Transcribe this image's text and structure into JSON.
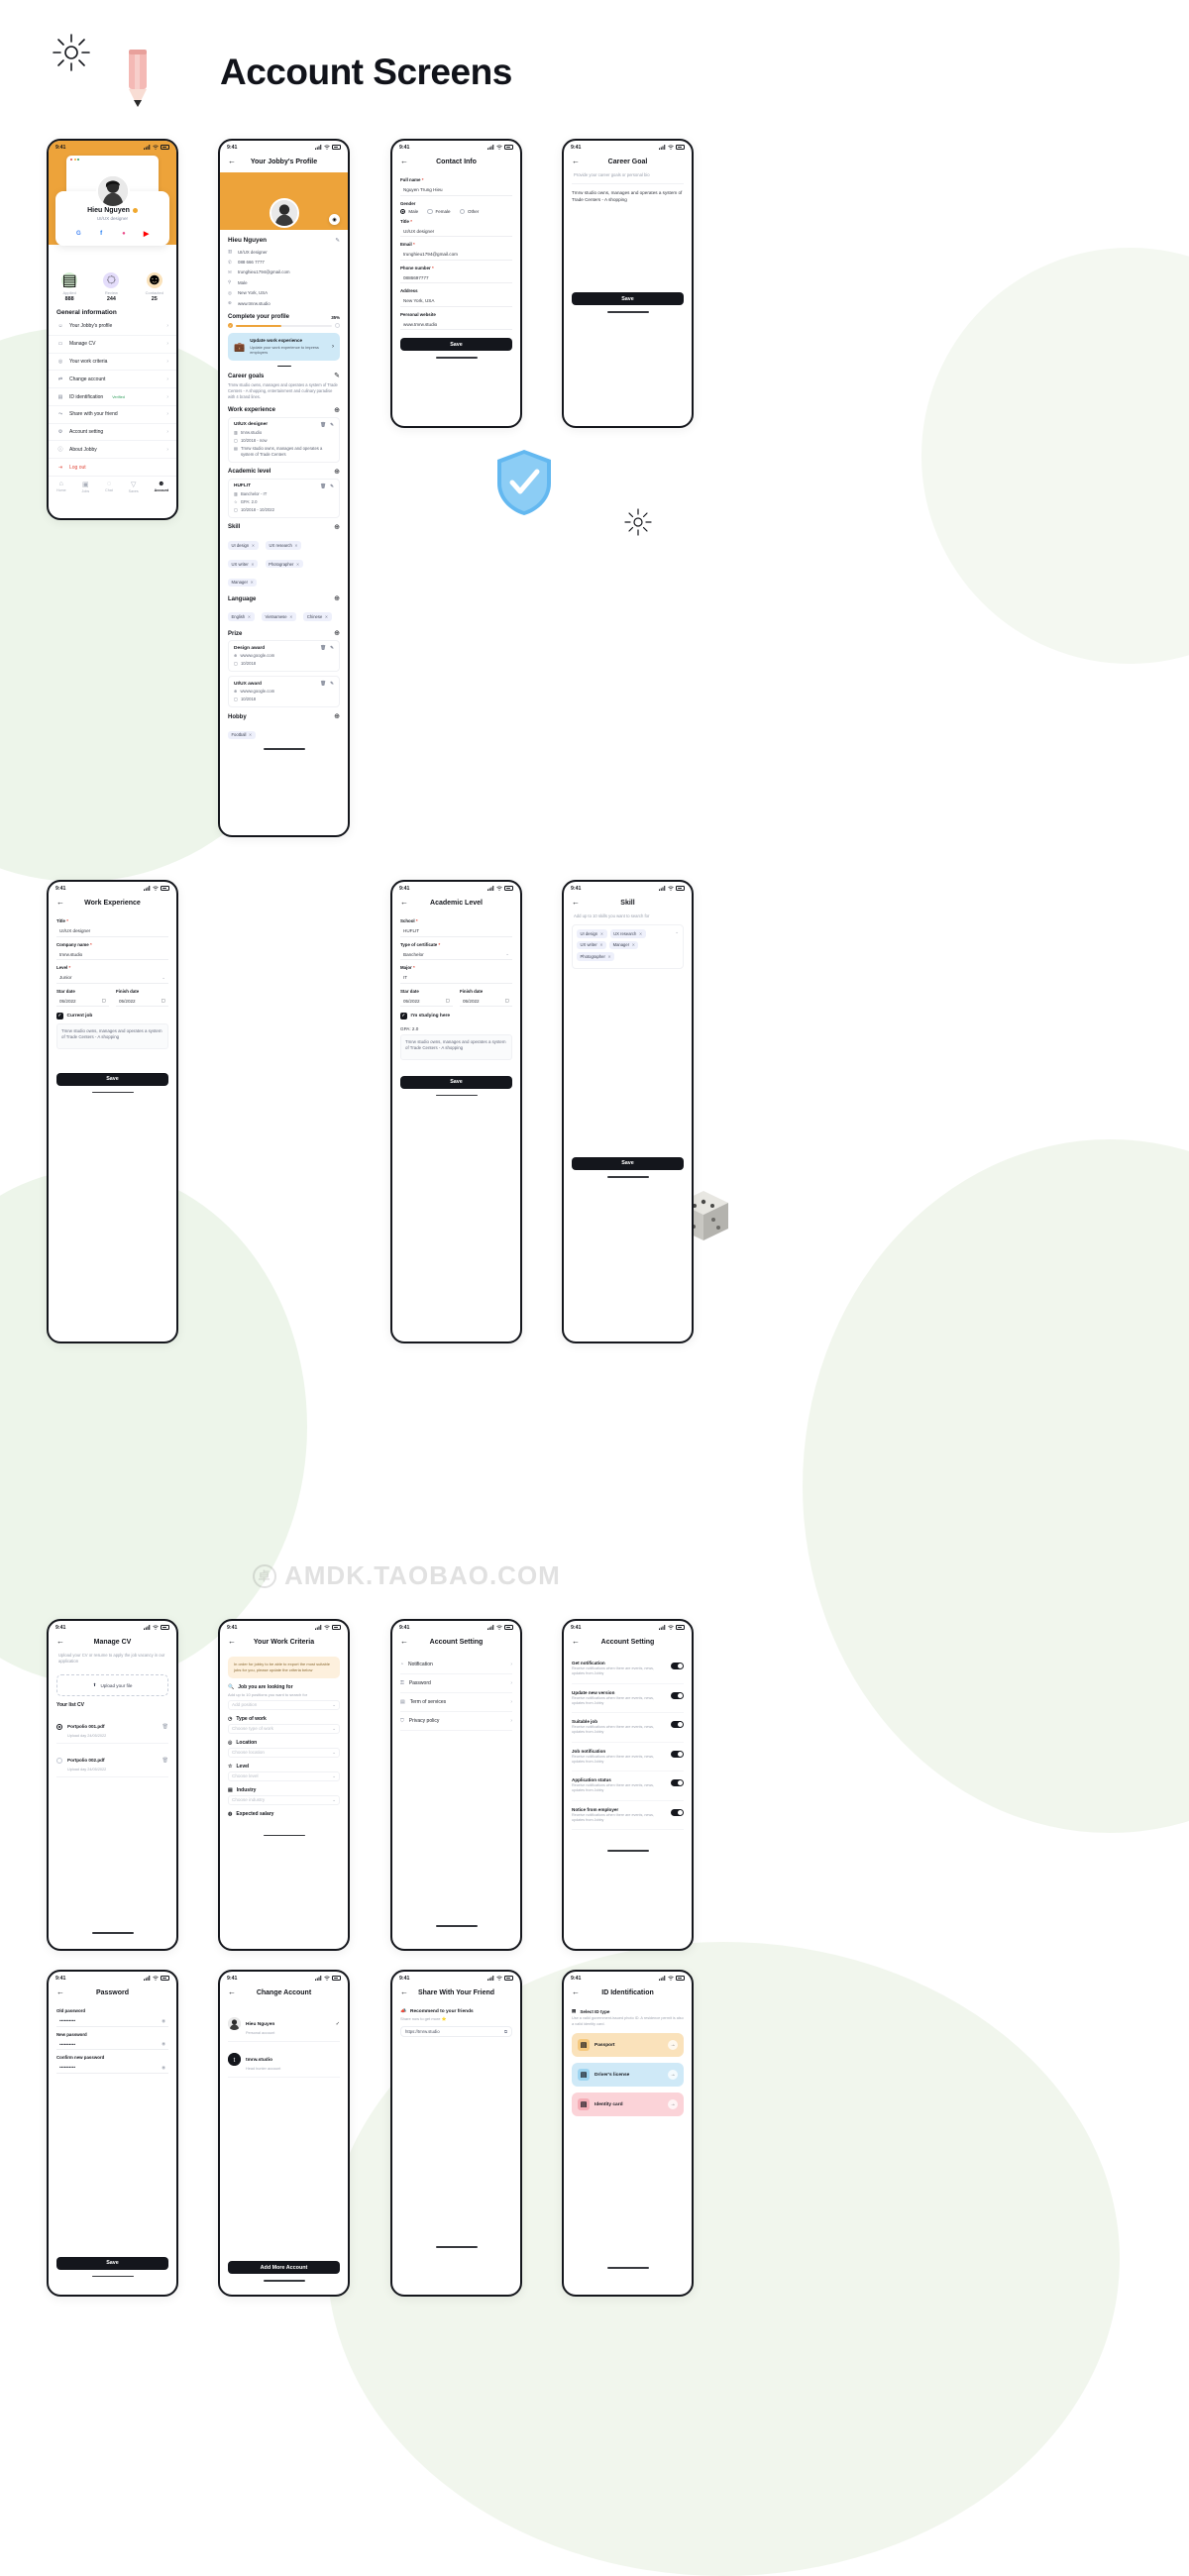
{
  "header": {
    "title": "Account Screens"
  },
  "watermark": "AMDK.TAOBAO.COM",
  "common": {
    "time": "9:41",
    "back_icon": "←",
    "save_label": "Save",
    "chevron": "›",
    "plus_icon": "⊕",
    "edit_icon": "✎",
    "trash_icon": "🗑",
    "calendar_icon": "▢",
    "required": "*"
  },
  "screens": {
    "account": {
      "nav_title": "",
      "user": {
        "name": "Hieu Nguyen",
        "role": "UI/UX designer"
      },
      "socials": [
        {
          "name": "google-icon",
          "glyph": "G",
          "color": "#4285F4",
          "bg": "#ffffff"
        },
        {
          "name": "facebook-icon",
          "glyph": "f",
          "color": "#1877F2",
          "bg": "#ffffff"
        },
        {
          "name": "dribbble-icon",
          "glyph": "●",
          "color": "#EA4C89",
          "bg": "#ffffff"
        },
        {
          "name": "youtube-icon",
          "glyph": "▶",
          "color": "#FF0000",
          "bg": "#ffffff"
        }
      ],
      "stats": [
        {
          "label": "Applied",
          "value": "888",
          "bg": "#d9f2d6"
        },
        {
          "label": "Review",
          "value": "244",
          "bg": "#e4ddfb"
        },
        {
          "label": "Contacted",
          "value": "25",
          "bg": "#fae2bb"
        }
      ],
      "section_title": "General information",
      "menu": [
        {
          "label": "Your Jobby's profile",
          "icon": "person-icon",
          "glyph": "☺"
        },
        {
          "label": "Manage CV",
          "icon": "folder-icon",
          "glyph": "▭"
        },
        {
          "label": "Your work criteria",
          "icon": "target-icon",
          "glyph": "◎"
        },
        {
          "label": "Change account",
          "icon": "switch-user-icon",
          "glyph": "⇄"
        },
        {
          "label": "ID identification",
          "icon": "id-card-icon",
          "glyph": "▤",
          "badge": "Verified"
        },
        {
          "label": "Share with your friend",
          "icon": "share-icon",
          "glyph": "⤳"
        },
        {
          "label": "Account setting",
          "icon": "gear-icon",
          "glyph": "⚙"
        },
        {
          "label": "About Jobby",
          "icon": "info-icon",
          "glyph": "ⓘ"
        },
        {
          "label": "Log out",
          "icon": "logout-icon",
          "glyph": "⇥"
        }
      ],
      "tabs": [
        {
          "label": "Home",
          "glyph": "⌂"
        },
        {
          "label": "Jobs",
          "glyph": "▣"
        },
        {
          "label": "Chat",
          "glyph": "◌"
        },
        {
          "label": "Saves",
          "glyph": "▽"
        },
        {
          "label": "Account",
          "glyph": "☻"
        }
      ]
    },
    "profile": {
      "nav_title": "Your Jobby's Profile",
      "name": "Hieu Nguyen",
      "details": [
        {
          "icon": "briefcase-icon",
          "glyph": "▥",
          "text": "UI/UX designer"
        },
        {
          "icon": "phone-icon",
          "glyph": "✆",
          "text": "088 666 7777"
        },
        {
          "icon": "mail-icon",
          "glyph": "✉",
          "text": "trunghieu1794@gmail.com"
        },
        {
          "icon": "gender-icon",
          "glyph": "⚲",
          "text": "Male"
        },
        {
          "icon": "location-icon",
          "glyph": "◎",
          "text": "New York, USA"
        },
        {
          "icon": "globe-icon",
          "glyph": "⊕",
          "text": "www.tmrw.studio"
        }
      ],
      "complete_title": "Complete your profile",
      "complete_pct": "35%",
      "tip": {
        "title": "Update work experience",
        "desc": "Update your work experience to impress employers",
        "icon": "briefcase-emoji"
      },
      "career_title": "Career goals",
      "career_text": "Tmrw studio owns, manages and operates a system of Trade Centers - A shopping, entertainment and culinary paradise with 4 brand lines.",
      "work_title": "Work experience",
      "work": [
        {
          "title": "UI/UX designer",
          "company": "tmrw.studio",
          "date": "10/2018 - now",
          "desc": "Tmrw studio owns, manages and operates a system of Trade Centers"
        }
      ],
      "academic_title": "Academic level",
      "academic": [
        {
          "school": "HUFLIT",
          "major": "Banchelor - IT",
          "gpa": "GPA: 2.0",
          "date": "10/2018 - 10/2022"
        }
      ],
      "skill_title": "Skill",
      "skills": [
        "UI design",
        "UX research",
        "UX writer",
        "Photographer",
        "Manager"
      ],
      "language_title": "Language",
      "languages": [
        "English",
        "Vietnamese",
        "Chinese"
      ],
      "prize_title": "Prize",
      "prizes": [
        {
          "name": "Design award",
          "link": "wwww.google.com",
          "date": "10/2018"
        },
        {
          "name": "UI/UX award",
          "link": "wwww.google.com",
          "date": "10/2018"
        }
      ],
      "hobby_title": "Hobby",
      "hobbies": [
        "Football"
      ]
    },
    "contact": {
      "nav_title": "Contact Info",
      "fields": [
        {
          "label": "Full name",
          "req": true,
          "value": "Nguyen Trung Hieu"
        },
        {
          "label": "Title",
          "req": true,
          "value": "UI/UX designer"
        },
        {
          "label": "Email",
          "req": true,
          "value": "trunghieu1794@gmail.com"
        },
        {
          "label": "Phone number",
          "req": true,
          "value": "0886697777"
        },
        {
          "label": "Address",
          "req": false,
          "value": "New York, USA"
        },
        {
          "label": "Personal website",
          "req": false,
          "value": "www.tmrw.studio"
        }
      ],
      "gender_label": "Gender",
      "gender_options": [
        "Male",
        "Female",
        "Other"
      ],
      "gender_selected": "Male"
    },
    "career_goal": {
      "nav_title": "Career Goal",
      "subtitle": "Provide your career goals or personal bio",
      "value": "Tmrw studio owns, manages and operates a system of Trade Centers - A shopping"
    },
    "work_experience": {
      "nav_title": "Work Experience",
      "fields": [
        {
          "label": "Title",
          "req": true,
          "value": "UI/UX designer"
        },
        {
          "label": "Company name",
          "req": true,
          "value": "tmrw.studio"
        },
        {
          "label": "Level",
          "req": true,
          "value": "Junior",
          "select": true
        }
      ],
      "start_label": "Star date",
      "finish_label": "Finish date",
      "start_value": "05/2022",
      "finish_value": "05/2022",
      "current_job": "Current job",
      "desc": "Tmrw studio owns, manages and operates a system of Trade Centers - A shopping"
    },
    "academic_level": {
      "nav_title": "Academic Level",
      "fields": [
        {
          "label": "School",
          "req": true,
          "value": "HUFLIT"
        },
        {
          "label": "Type of certificate",
          "req": true,
          "value": "Banchelor",
          "select": true
        },
        {
          "label": "Major",
          "req": true,
          "value": "IT"
        }
      ],
      "start_label": "Star date",
      "finish_label": "Finish date",
      "start_value": "05/2022",
      "finish_value": "05/2022",
      "studying": "I'm studying here",
      "gpa_label": "GPA: 2.0",
      "desc": "Tmrw studio owns, manages and operates a system of Trade Centers - A shopping"
    },
    "skill": {
      "nav_title": "Skill",
      "subtitle": "Add up to 10 skills you want to search for",
      "tags": [
        "UI design",
        "UX research",
        "UX writer",
        "Manager",
        "Photographer"
      ]
    },
    "manage_cv": {
      "nav_title": "Manage CV",
      "subtitle": "Upload your CV or resume to apply the job vacancy in our application",
      "upload_label": "Upload your file",
      "list_title": "Your list CV",
      "files": [
        {
          "name": "Portpolio 001.pdf",
          "date": "Upload day 24/05/2022",
          "selected": true
        },
        {
          "name": "Portpolio 002.pdf",
          "date": "Upload day 24/05/2022",
          "selected": false
        }
      ]
    },
    "work_criteria": {
      "nav_title": "Your Work Criteria",
      "warning": "In order for jobby to be able to export the most suitable jobs for you, please update the criteria below",
      "q_title": "Job you are looking for",
      "q_sub": "Add up to 10 positions you want to search for",
      "position_ph": "Add position",
      "sections": [
        {
          "label": "Type of work",
          "icon": "clock-icon",
          "glyph": "◷",
          "ph": "Choose type of work"
        },
        {
          "label": "Location",
          "icon": "location-icon",
          "glyph": "◎",
          "ph": "Choose location"
        },
        {
          "label": "Level",
          "icon": "star-icon",
          "glyph": "☆",
          "ph": "Choose level"
        },
        {
          "label": "Industry",
          "icon": "building-icon",
          "glyph": "▤",
          "ph": "Choose industry"
        },
        {
          "label": "Expected salary",
          "icon": "money-icon",
          "glyph": "◍",
          "ph": ""
        }
      ]
    },
    "account_setting": {
      "nav_title": "Account Setting",
      "rows": [
        {
          "label": "Notification",
          "icon": "bell-icon",
          "glyph": "◔"
        },
        {
          "label": "Password",
          "icon": "lock-icon",
          "glyph": "⚿"
        },
        {
          "label": "Term of services",
          "icon": "doc-icon",
          "glyph": "▤"
        },
        {
          "label": "Privacy policy",
          "icon": "shield-icon",
          "glyph": "⛉"
        }
      ]
    },
    "notifications": {
      "nav_title": "Account Setting",
      "items": [
        {
          "title": "Get notification",
          "desc": "Receive notifications when there are events, news, updates from Jobby",
          "on": true
        },
        {
          "title": "Update new version",
          "desc": "Receive notifications when there are events, news, updates from Jobby",
          "on": true
        },
        {
          "title": "Suitable job",
          "desc": "Receive notifications when there are events, news, updates from Jobby",
          "on": true
        },
        {
          "title": "Job notification",
          "desc": "Receive notifications when there are events, news, updates from Jobby",
          "on": true
        },
        {
          "title": "Application status",
          "desc": "Receive notifications when there are events, news, updates from Jobby",
          "on": true
        },
        {
          "title": "Notice from employer",
          "desc": "Receive notifications when there are events, news, updates from Jobby",
          "on": true
        }
      ]
    },
    "password": {
      "nav_title": "Password",
      "fields": [
        {
          "label": "Old password",
          "value": "••••••••••"
        },
        {
          "label": "New password",
          "value": "••••••••••"
        },
        {
          "label": "Confirm new password",
          "value": "••••••••••"
        }
      ]
    },
    "change_account": {
      "nav_title": "Change Account",
      "accounts": [
        {
          "name": "Hieu Nguyen",
          "sub": "Personal account",
          "selected": true
        },
        {
          "name": "tmrw.studio",
          "sub": "Head hunter account",
          "selected": false
        }
      ],
      "button": "Add More Account"
    },
    "share": {
      "nav_title": "Share With Your Friend",
      "heading": "Recommend to your friends",
      "sub": "Share now to get more ⭐",
      "link": "https://tmrw.studio"
    },
    "id_identification": {
      "nav_title": "ID Identification",
      "select_title": "Select ID type",
      "note": "Use a valid government-issued photo ID. A residence permit is also a valid identity card.",
      "options": [
        {
          "label": "Passport",
          "bg": "#fae2bb",
          "icon": "passport-icon",
          "glyph": "▤"
        },
        {
          "label": "Driver's license",
          "bg": "#cfe9f7",
          "icon": "license-icon",
          "glyph": "▤"
        },
        {
          "label": "Identity card",
          "bg": "#fbd3d8",
          "icon": "idcard-icon",
          "glyph": "▤"
        }
      ]
    }
  }
}
